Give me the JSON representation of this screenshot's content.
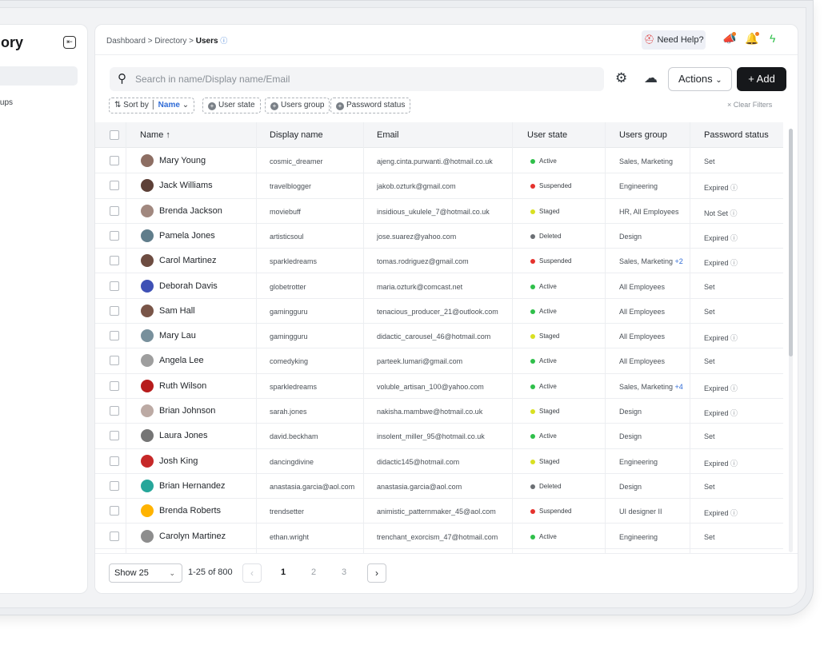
{
  "sidebar": {
    "title": "ory",
    "collapse_icon": "collapse-sidebar-icon",
    "item_label": "roups"
  },
  "breadcrumb": {
    "part1": "Dashboard > ",
    "part2": "Directory > ",
    "current": "Users",
    "info": "ⓘ"
  },
  "topbar": {
    "help_label": "Need Help?"
  },
  "search": {
    "placeholder": "Search in name/Display name/Email"
  },
  "toolbar": {
    "actions_label": "Actions",
    "add_label": "+ Add"
  },
  "filters": {
    "sort_prefix": "Sort by",
    "sort_value": "Name",
    "chips": [
      "User state",
      "Users group",
      "Password status"
    ],
    "clear_label": "Clear Filters"
  },
  "table": {
    "columns": [
      "Name  ↑",
      "Display name",
      "Email",
      "User state",
      "Users group",
      "Password status"
    ],
    "rows": [
      {
        "name": "Mary Young",
        "display": "cosmic_dreamer",
        "email": "ajeng.cinta.purwanti.@hotmail.co.uk",
        "state": "Active",
        "group": "Sales, Marketing",
        "more": "",
        "password": "Set",
        "pinfo": false
      },
      {
        "name": "Jack Williams",
        "display": "travelblogger",
        "email": "jakob.ozturk@gmail.com",
        "state": "Suspended",
        "group": "Engineering",
        "more": "",
        "password": "Expired",
        "pinfo": true
      },
      {
        "name": "Brenda Jackson",
        "display": "moviebuff",
        "email": "insidious_ukulele_7@hotmail.co.uk",
        "state": "Staged",
        "group": "HR, All Employees",
        "more": "",
        "password": "Not Set",
        "pinfo": true
      },
      {
        "name": "Pamela Jones",
        "display": "artisticsoul",
        "email": "jose.suarez@yahoo.com",
        "state": "Deleted",
        "group": "Design",
        "more": "",
        "password": "Expired",
        "pinfo": true
      },
      {
        "name": "Carol Martinez",
        "display": "sparkledreams",
        "email": "tomas.rodriguez@gmail.com",
        "state": "Suspended",
        "group": "Sales, Marketing",
        "more": "+2",
        "password": "Expired",
        "pinfo": true
      },
      {
        "name": "Deborah Davis",
        "display": "globetrotter",
        "email": "maria.ozturk@comcast.net",
        "state": "Active",
        "group": "All Employees",
        "more": "",
        "password": "Set",
        "pinfo": false
      },
      {
        "name": "Sam Hall",
        "display": "gamingguru",
        "email": "tenacious_producer_21@outlook.com",
        "state": "Active",
        "group": "All Employees",
        "more": "",
        "password": "Set",
        "pinfo": false
      },
      {
        "name": "Mary Lau",
        "display": "gamingguru",
        "email": "didactic_carousel_46@hotmail.com",
        "state": "Staged",
        "group": "All Employees",
        "more": "",
        "password": "Expired",
        "pinfo": true
      },
      {
        "name": "Angela Lee",
        "display": "comedyking",
        "email": "parteek.lumari@gmail.com",
        "state": "Active",
        "group": "All Employees",
        "more": "",
        "password": "Set",
        "pinfo": false
      },
      {
        "name": "Ruth Wilson",
        "display": "sparkledreams",
        "email": "voluble_artisan_100@yahoo.com",
        "state": "Active",
        "group": "Sales, Marketing",
        "more": "+4",
        "password": "Expired",
        "pinfo": true
      },
      {
        "name": "Brian Johnson",
        "display": "sarah.jones",
        "email": "nakisha.mambwe@hotmail.co.uk",
        "state": "Staged",
        "group": "Design",
        "more": "",
        "password": "Expired",
        "pinfo": true
      },
      {
        "name": "Laura Jones",
        "display": "david.beckham",
        "email": "insolent_miller_95@hotmail.co.uk",
        "state": "Active",
        "group": "Design",
        "more": "",
        "password": "Set",
        "pinfo": false
      },
      {
        "name": "Josh King",
        "display": "dancingdivine",
        "email": "didactic145@hotmail.com",
        "state": "Staged",
        "group": "Engineering",
        "more": "",
        "password": "Expired",
        "pinfo": true
      },
      {
        "name": "Brian Hernandez",
        "display": "anastasia.garcia@aol.com",
        "email": "anastasia.garcia@aol.com",
        "state": "Deleted",
        "group": "Design",
        "more": "",
        "password": "Set",
        "pinfo": false
      },
      {
        "name": "Brenda Roberts",
        "display": "trendsetter",
        "email": "animistic_patternmaker_45@aol.com",
        "state": "Suspended",
        "group": "UI designer II",
        "more": "",
        "password": "Expired",
        "pinfo": true
      },
      {
        "name": "Carolyn Martinez",
        "display": "ethan.wright",
        "email": "trenchant_exorcism_47@hotmail.com",
        "state": "Active",
        "group": "Engineering",
        "more": "",
        "password": "Set",
        "pinfo": false
      },
      {
        "name": "",
        "display": "",
        "email": "",
        "state": "",
        "group": "",
        "more": "",
        "password": "",
        "pinfo": false
      }
    ]
  },
  "state_colors": {
    "Active": "#2fbf4a",
    "Suspended": "#e5322d",
    "Staged": "#d9e021",
    "Deleted": "#6b6f74"
  },
  "avatar_colors": [
    "#8d6e63",
    "#5d4037",
    "#a1887f",
    "#607d8b",
    "#6d4c41",
    "#3f51b5",
    "#795548",
    "#78909c",
    "#9e9e9e",
    "#b71c1c",
    "#bcaaa4",
    "#757575",
    "#c62828",
    "#26a69a",
    "#ffb300",
    "#8d8d8d",
    "#5d4037"
  ],
  "pagination": {
    "show_label": "Show 25",
    "range": "1-25 of 800",
    "pages": [
      "1",
      "2",
      "3"
    ],
    "current_page": "1"
  }
}
